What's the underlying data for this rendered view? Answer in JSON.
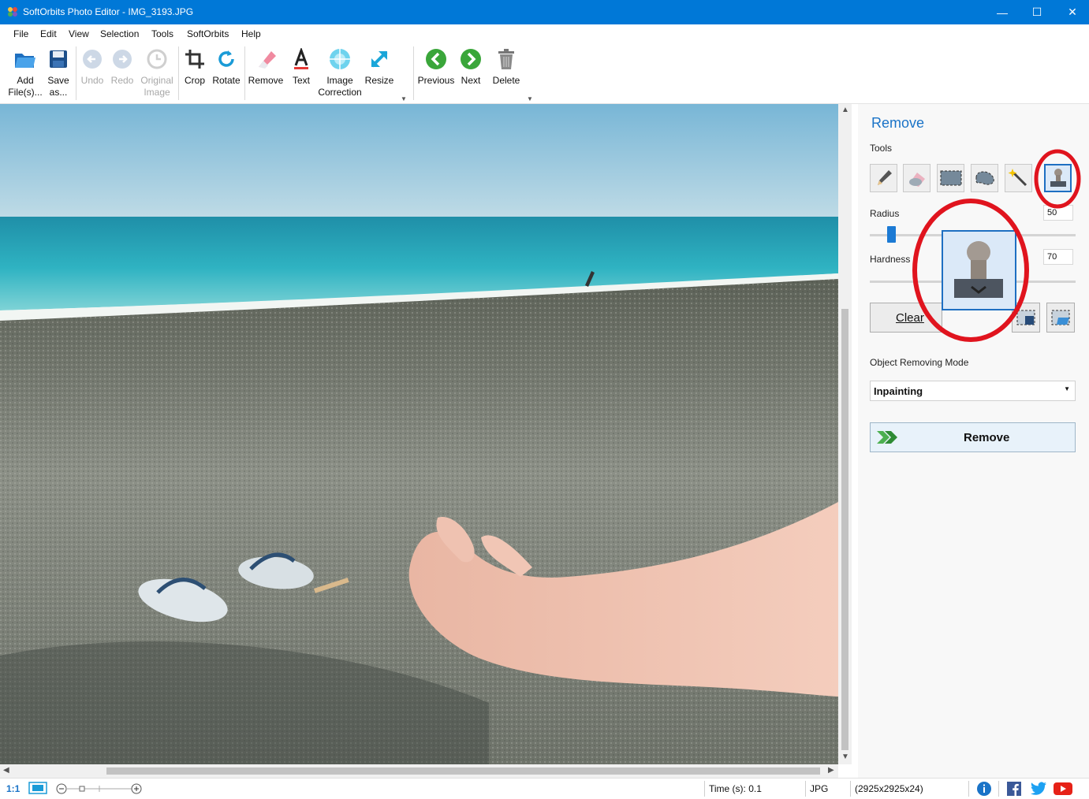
{
  "window": {
    "title": "SoftOrbits Photo Editor - IMG_3193.JPG"
  },
  "menu": [
    "File",
    "Edit",
    "View",
    "Selection",
    "Tools",
    "SoftOrbits",
    "Help"
  ],
  "toolbar": {
    "add_files": {
      "line1": "Add",
      "line2": "File(s)..."
    },
    "save_as": {
      "line1": "Save",
      "line2": "as..."
    },
    "undo": "Undo",
    "redo": "Redo",
    "original_image": {
      "line1": "Original",
      "line2": "Image"
    },
    "crop": "Crop",
    "rotate": "Rotate",
    "remove": "Remove",
    "text": "Text",
    "image_correction": {
      "line1": "Image",
      "line2": "Correction"
    },
    "resize": "Resize",
    "previous": "Previous",
    "next": "Next",
    "delete": "Delete"
  },
  "panel": {
    "title": "Remove",
    "tools_label": "Tools",
    "tools": [
      "pencil-icon",
      "eraser-icon",
      "rect-select-icon",
      "lasso-icon",
      "magic-wand-icon",
      "stamp-icon"
    ],
    "active_tool": "stamp-icon",
    "radius_label": "Radius",
    "radius_value": "50",
    "radius_fraction": 0.11,
    "hardness_label": "Hardness",
    "hardness_value": "70",
    "clear_label": "Clear",
    "mode_label": "Object Removing Mode",
    "mode_value": "Inpainting",
    "remove_button": "Remove"
  },
  "status": {
    "zoom_label": "1:1",
    "time": "Time (s): 0.1",
    "format": "JPG",
    "dimensions": "(2925x2925x24)"
  },
  "colors": {
    "titlebar": "#0078d7",
    "accent": "#1a73c7",
    "highlight_ring": "#e0141e"
  }
}
